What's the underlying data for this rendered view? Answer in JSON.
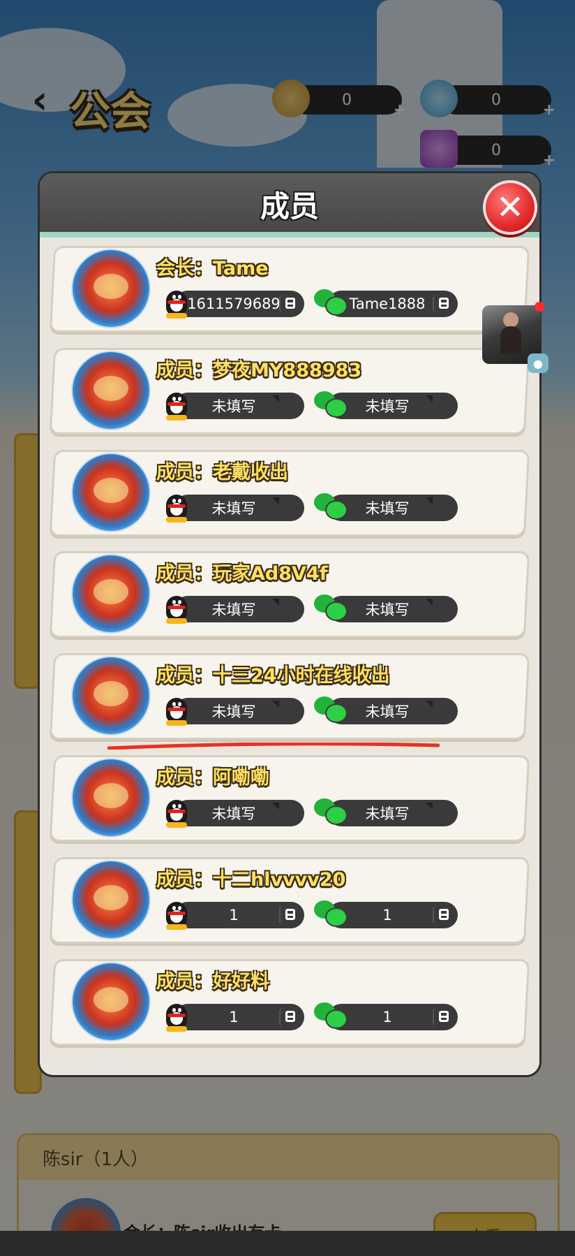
{
  "header": {
    "back_icon": "chevron-left-icon",
    "title": "公会",
    "currencies": [
      {
        "icon": "coin-icon",
        "value": "0"
      },
      {
        "icon": "gem-icon",
        "value": "0"
      },
      {
        "icon": "ticket-icon",
        "value": "0"
      }
    ],
    "plus": "+"
  },
  "modal": {
    "title": "成员",
    "close_icon": "close-icon",
    "members": [
      {
        "name": "会长：Tame",
        "qq": "1611579689",
        "wechat": "Tame1888",
        "qq_copy": true,
        "wechat_copy": true
      },
      {
        "name": "成员：梦夜MY888983",
        "qq": "未填写",
        "wechat": "未填写",
        "qq_copy": false,
        "wechat_copy": false
      },
      {
        "name": "成员：老戴收出",
        "qq": "未填写",
        "wechat": "未填写",
        "qq_copy": false,
        "wechat_copy": false
      },
      {
        "name": "成员：玩家Ad8V4f",
        "qq": "未填写",
        "wechat": "未填写",
        "qq_copy": false,
        "wechat_copy": false
      },
      {
        "name": "成员：十三24小时在线收出",
        "qq": "未填写",
        "wechat": "未填写",
        "qq_copy": false,
        "wechat_copy": false
      },
      {
        "name": "成员：阿嘞嘞",
        "qq": "未填写",
        "wechat": "未填写",
        "qq_copy": false,
        "wechat_copy": false
      },
      {
        "name": "成员：十二hlvvvv20",
        "qq": "1",
        "wechat": "1",
        "qq_copy": true,
        "wechat_copy": true
      },
      {
        "name": "成员：好好料",
        "qq": "1",
        "wechat": "1",
        "qq_copy": true,
        "wechat_copy": true
      }
    ]
  },
  "background_panel": {
    "guild_header": "陈sir（1人）",
    "leader_text": "会长：陈sir收出有卡",
    "view_button": "查看"
  },
  "colors": {
    "modal_header": "#4f4f4f",
    "name_text": "#ffe062",
    "close_button": "#e32a2a",
    "annotation_line": "#e8321f"
  }
}
